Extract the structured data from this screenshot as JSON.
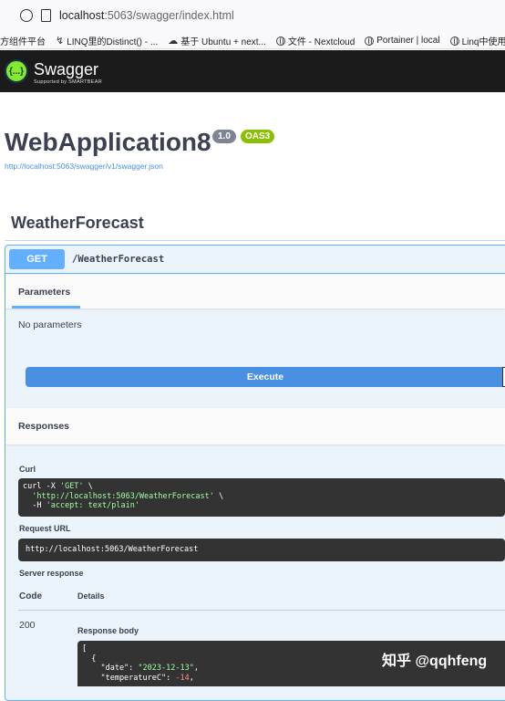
{
  "browser": {
    "url_host": "localhost",
    "url_rest": ":5063/swagger/index.html",
    "bookmarks": [
      {
        "icon": "text-icon",
        "label": "方组件平台"
      },
      {
        "icon": "link-icon",
        "label": "LINQ里的Distinct() - ..."
      },
      {
        "icon": "cloud-icon",
        "label": "基于 Ubuntu + next..."
      },
      {
        "icon": "globe-icon",
        "label": "文件 - Nextcloud"
      },
      {
        "icon": "globe-icon",
        "label": "Portainer | local"
      },
      {
        "icon": "globe-icon",
        "label": "Linq中使用"
      }
    ]
  },
  "swagger": {
    "logo_text": "Swagger",
    "logo_sub": "Supported by SMARTBEAR",
    "logo_glyph": "{...}"
  },
  "info": {
    "title": "WebApplication8",
    "version": "1.0",
    "oas": "OAS3",
    "spec_url": "http://localhost:5063/swagger/v1/swagger.json"
  },
  "tag": "WeatherForecast",
  "operation": {
    "method": "GET",
    "path": "/WeatherForecast",
    "parameters_tab": "Parameters",
    "no_params": "No parameters",
    "execute": "Execute",
    "responses_title": "Responses",
    "curl_label": "Curl",
    "curl_lines": [
      "curl -X 'GET' \\",
      "  'http://localhost:5063/WeatherForecast' \\",
      "  -H 'accept: text/plain'"
    ],
    "request_url_label": "Request URL",
    "request_url": "http://localhost:5063/WeatherForecast",
    "server_response_label": "Server response",
    "col_code": "Code",
    "col_details": "Details",
    "status_code": "200",
    "response_body_label": "Response body",
    "body_lines": [
      "[",
      "  {",
      "    \"date\": \"2023-12-13\",",
      "    \"temperatureC\": -14,"
    ]
  },
  "watermark": "知乎 @qqhfeng",
  "colors": {
    "get": "#61affe",
    "execute": "#4990e2",
    "oas": "#89bf04",
    "topbar": "#1b1b1b"
  }
}
